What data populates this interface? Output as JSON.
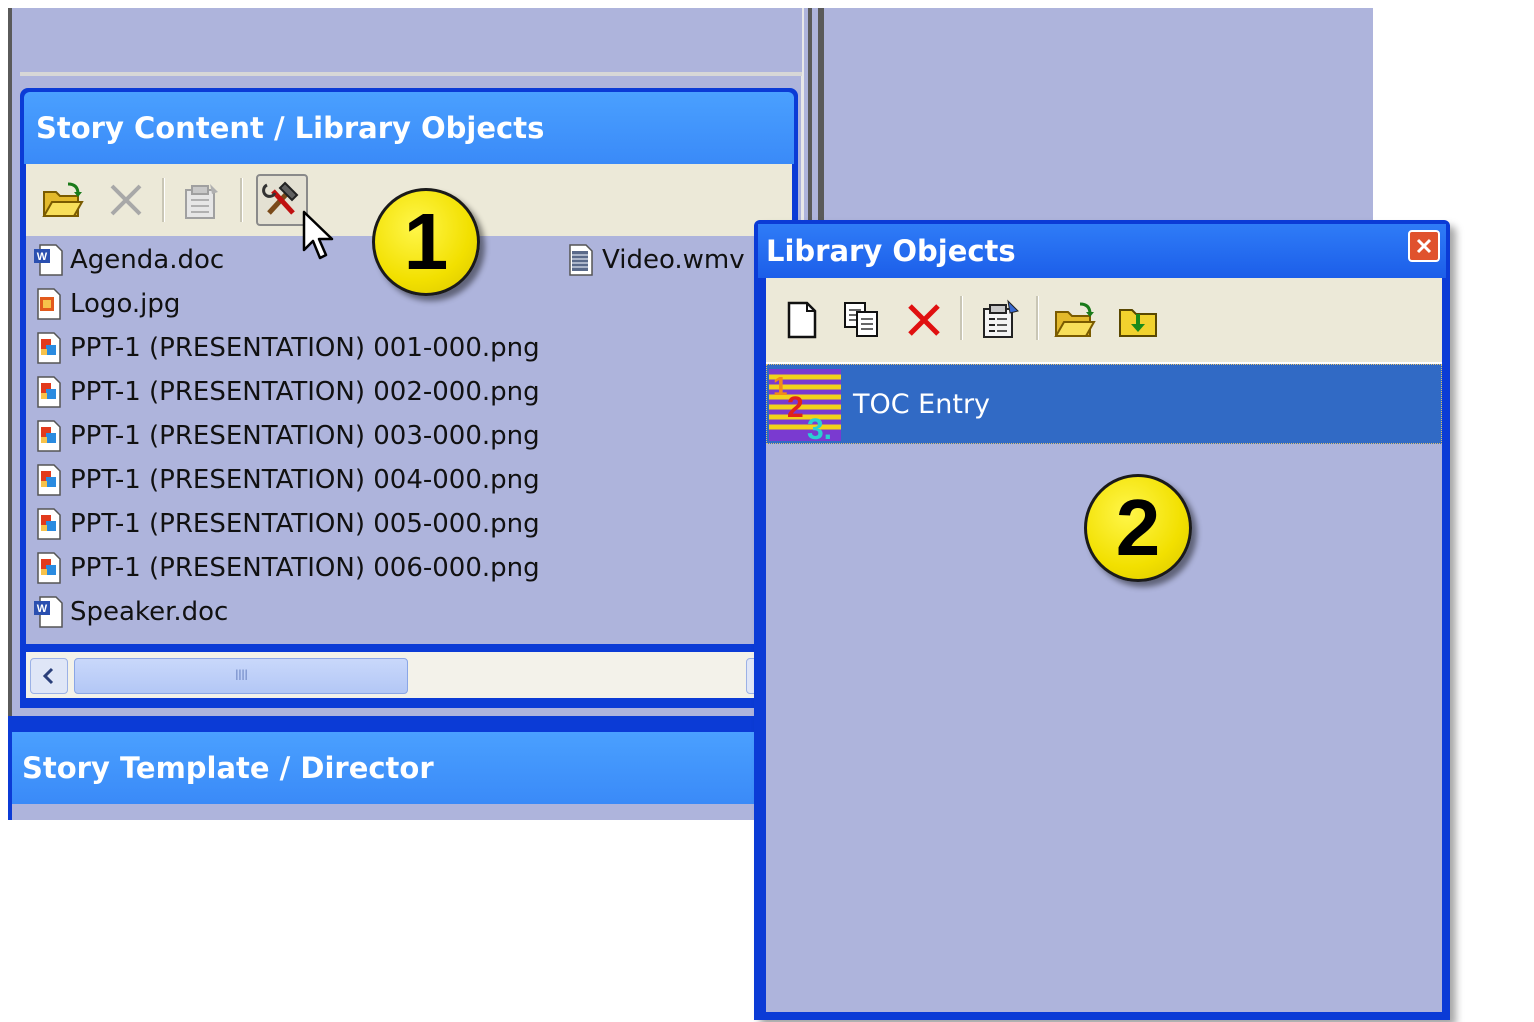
{
  "story_content": {
    "title": "Story Content / Library Objects",
    "toolbar": [
      {
        "name": "open-folder",
        "icon": "open-folder-icon"
      },
      {
        "name": "delete",
        "icon": "delete-icon",
        "disabled": true
      },
      {
        "name": "properties",
        "icon": "properties-icon",
        "disabled": true
      },
      {
        "name": "library-objects",
        "icon": "tools-icon",
        "pressed": true
      }
    ],
    "files": [
      {
        "label": "Agenda.doc",
        "icon": "word-doc-icon"
      },
      {
        "label": "Logo.jpg",
        "icon": "image-file-icon"
      },
      {
        "label": "PPT-1 (PRESENTATION) 001-000.png",
        "icon": "png-file-icon"
      },
      {
        "label": "PPT-1 (PRESENTATION) 002-000.png",
        "icon": "png-file-icon"
      },
      {
        "label": "PPT-1 (PRESENTATION) 003-000.png",
        "icon": "png-file-icon"
      },
      {
        "label": "PPT-1 (PRESENTATION) 004-000.png",
        "icon": "png-file-icon"
      },
      {
        "label": "PPT-1 (PRESENTATION) 005-000.png",
        "icon": "png-file-icon"
      },
      {
        "label": "PPT-1 (PRESENTATION) 006-000.png",
        "icon": "png-file-icon"
      },
      {
        "label": "Speaker.doc",
        "icon": "word-doc-icon"
      },
      {
        "label": "Video.wmv",
        "icon": "video-file-icon"
      }
    ],
    "scrollbar_thumb_grip": "IIII"
  },
  "story_template": {
    "title": "Story Template / Director"
  },
  "library_objects": {
    "title": "Library Objects",
    "toolbar": [
      "new-icon",
      "copy-icon",
      "delete-icon",
      "properties-icon",
      "open-folder-icon",
      "import-icon"
    ],
    "items": [
      {
        "label": "TOC Entry",
        "icon": "toc-entry-icon",
        "selected": true
      }
    ]
  },
  "callouts": {
    "one": "1",
    "two": "2"
  },
  "colors": {
    "panel_bg": "#aeb4dc",
    "title_blue": "#3a8af8",
    "frame_blue": "#0b3bd6",
    "toolbar_bg": "#ece9d8",
    "selection": "#316ac5",
    "callout_yellow": "#f2e000"
  }
}
